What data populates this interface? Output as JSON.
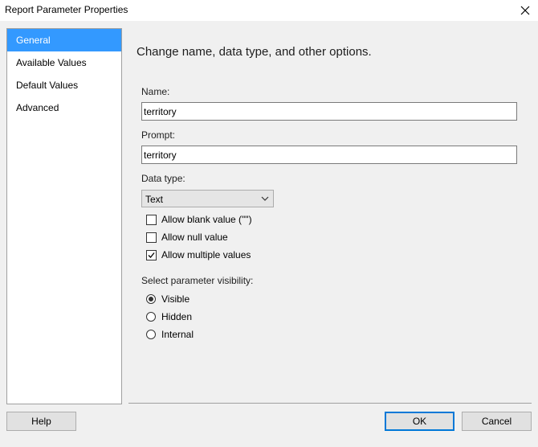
{
  "window": {
    "title": "Report Parameter Properties"
  },
  "nav": {
    "items": [
      {
        "label": "General",
        "selected": true
      },
      {
        "label": "Available Values",
        "selected": false
      },
      {
        "label": "Default Values",
        "selected": false
      },
      {
        "label": "Advanced",
        "selected": false
      }
    ]
  },
  "general": {
    "heading": "Change name, data type, and other options.",
    "name_label": "Name:",
    "name_value": "territory",
    "prompt_label": "Prompt:",
    "prompt_value": "territory",
    "data_type_label": "Data type:",
    "data_type_value": "Text",
    "options": [
      {
        "label": "Allow blank value (\"\")",
        "checked": false
      },
      {
        "label": "Allow null value",
        "checked": false
      },
      {
        "label": "Allow multiple values",
        "checked": true
      }
    ],
    "visibility_label": "Select parameter visibility:",
    "visibility": [
      {
        "label": "Visible",
        "selected": true
      },
      {
        "label": "Hidden",
        "selected": false
      },
      {
        "label": "Internal",
        "selected": false
      }
    ]
  },
  "buttons": {
    "help": "Help",
    "ok": "OK",
    "cancel": "Cancel"
  },
  "colors": {
    "selection": "#3399ff",
    "default_button_border": "#0078d7"
  }
}
